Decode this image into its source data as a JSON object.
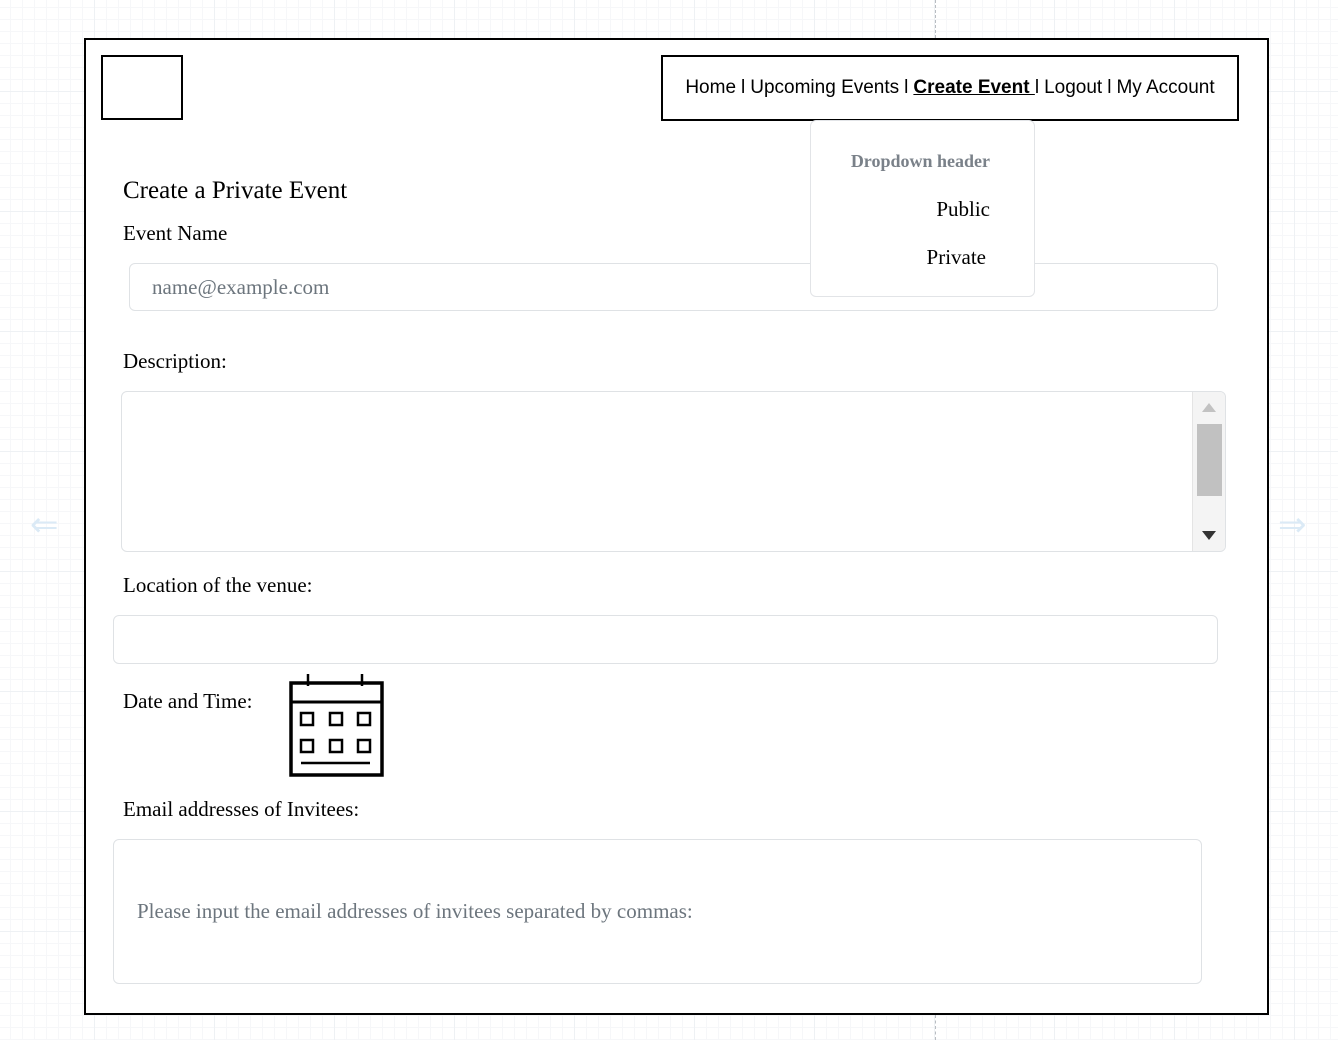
{
  "nav": {
    "items": [
      {
        "label": "Home"
      },
      {
        "label": "Upcoming Events"
      },
      {
        "label": "Create Event "
      },
      {
        "label": "Logout"
      },
      {
        "label": "My Account"
      }
    ],
    "separator": "l",
    "active_item": "Create Event"
  },
  "dropdown": {
    "header": "Dropdown header",
    "items": [
      "Public",
      "Private"
    ]
  },
  "form": {
    "title": "Create a Private Event",
    "event_name": {
      "label": "Event Name",
      "placeholder": "name@example.com",
      "value": ""
    },
    "description": {
      "label": "Description:",
      "value": ""
    },
    "location": {
      "label": "Location of the venue:",
      "value": ""
    },
    "date_time": {
      "label": "Date and Time:",
      "icon": "calendar-icon"
    },
    "invitees": {
      "label": "Email addresses of Invitees:",
      "placeholder": "Please input the email addresses of invitees separated by commas:"
    }
  },
  "colors": {
    "border": "#000000",
    "placeholder": "#6c757d",
    "dropdown_header": "#7a8189",
    "input_border": "#dfe2e5"
  }
}
